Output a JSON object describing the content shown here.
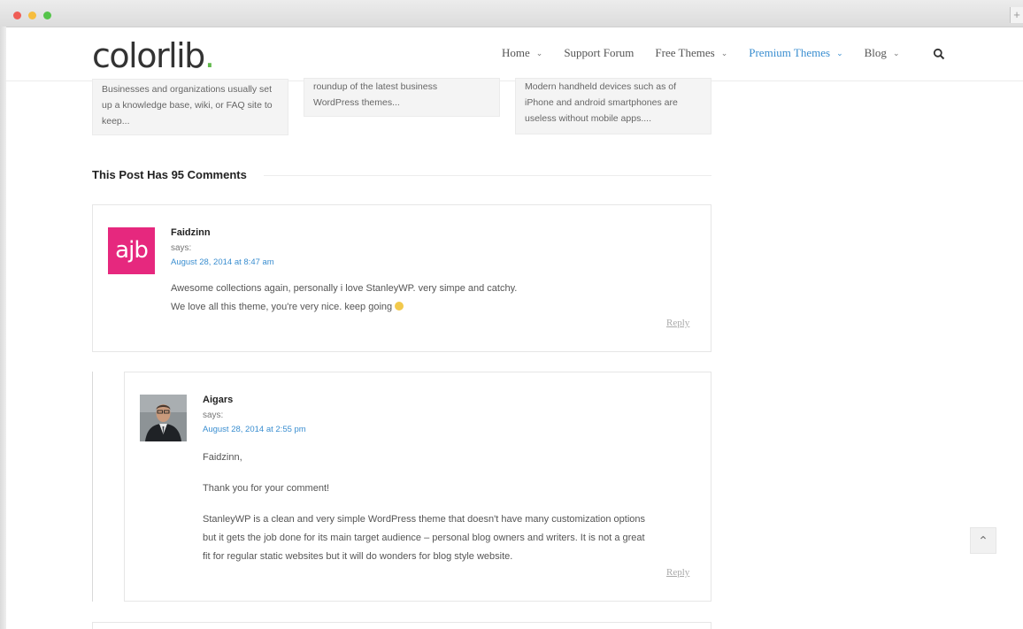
{
  "site": {
    "logo_text": "colorlib",
    "logo_dot": ".",
    "brand_green": "#61b94c",
    "link_blue": "#3a8ed0"
  },
  "nav": {
    "items": [
      {
        "label": "Home",
        "has_dropdown": true,
        "active": false
      },
      {
        "label": "Support Forum",
        "has_dropdown": false,
        "active": false
      },
      {
        "label": "Free Themes",
        "has_dropdown": true,
        "active": false
      },
      {
        "label": "Premium Themes",
        "has_dropdown": true,
        "active": true
      },
      {
        "label": "Blog",
        "has_dropdown": true,
        "active": false
      }
    ],
    "search_icon": "search-icon"
  },
  "related": {
    "cards": [
      {
        "lines": [
          "Businesses and organizations usually set",
          "up a knowledge base, wiki, or FAQ site to",
          "keep..."
        ]
      },
      {
        "lines": [
          "roundup of the latest business",
          "WordPress themes..."
        ]
      },
      {
        "lines": [
          "Modern handheld devices such as of",
          "iPhone and android smartphones are",
          "useless without mobile apps...."
        ]
      }
    ]
  },
  "comments": {
    "heading": "This Post Has 95 Comments",
    "list": [
      {
        "author": "Faidzinn",
        "avatar_text": "ajb",
        "says": "says:",
        "date": "August 28, 2014 at 8:47 am",
        "paragraphs": [
          "Awesome collections again, personally i love StanleyWP. very simpe and catchy.",
          "We love all this theme, you're very nice. keep going"
        ],
        "reply": "Reply"
      },
      {
        "author": "Aigars",
        "says": "says:",
        "date": "August 28, 2014 at 2:55 pm",
        "paragraphs": [
          "Faidzinn,",
          "Thank you for your comment!",
          "StanleyWP is a clean and very simple WordPress theme that doesn't have many customization options",
          "but it gets the job done for its main target audience – personal blog owners and writers. It is not a great",
          "fit for regular static websites but it will do wonders for blog style website."
        ],
        "reply": "Reply"
      }
    ]
  },
  "ui": {
    "scroll_top_glyph": "⌃",
    "new_tab_glyph": "+"
  }
}
